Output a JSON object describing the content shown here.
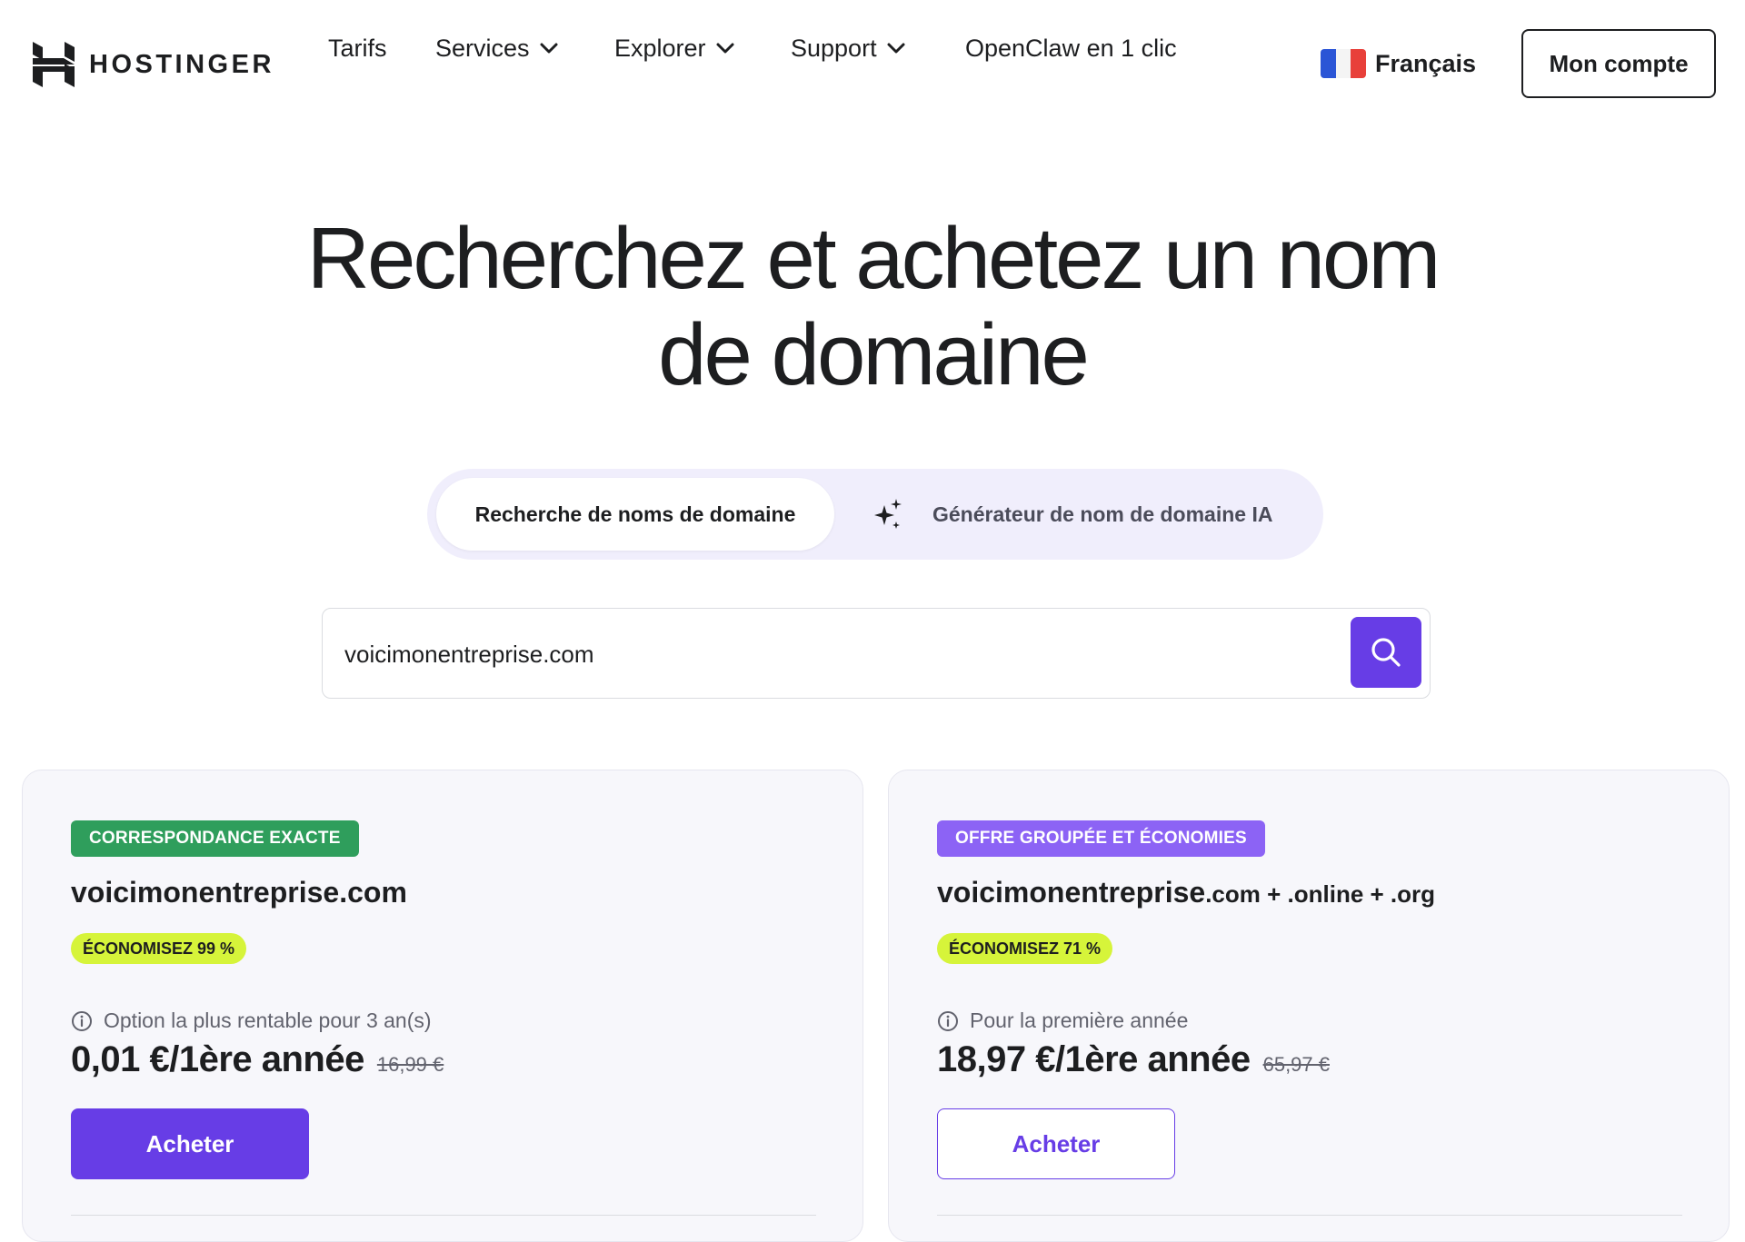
{
  "header": {
    "logo_text": "HOSTINGER",
    "nav": [
      {
        "label": "Tarifs",
        "has_dropdown": false
      },
      {
        "label": "Services",
        "has_dropdown": true
      },
      {
        "label": "Explorer",
        "has_dropdown": true
      },
      {
        "label": "Support",
        "has_dropdown": true
      },
      {
        "label": "OpenClaw en 1 clic",
        "has_dropdown": false
      }
    ],
    "language": "Français",
    "account_button": "Mon compte"
  },
  "hero": {
    "title_line1": "Recherchez et achetez un nom",
    "title_line2": "de domaine"
  },
  "tabs": {
    "search_tab": "Recherche de noms de domaine",
    "ai_tab": "Générateur de nom de domaine IA"
  },
  "search": {
    "value": "voicimonentreprise.com"
  },
  "cards": [
    {
      "tag": "CORRESPONDANCE EXACTE",
      "domain": "voicimonentreprise.com",
      "domain_suffix": "",
      "save": "ÉCONOMISEZ 99 %",
      "info": "Option la plus rentable pour 3 an(s)",
      "price": "0,01 €/1ère année",
      "old_price": "16,99 €",
      "button": "Acheter"
    },
    {
      "tag": "OFFRE GROUPÉE ET ÉCONOMIES",
      "domain": "voicimonentreprise",
      "domain_suffix": ".com + .online + .org",
      "save": "ÉCONOMISEZ 71 %",
      "info": "Pour la première année",
      "price": "18,97 €/1ère année",
      "old_price": "65,97 €",
      "button": "Acheter"
    }
  ],
  "colors": {
    "brand_purple": "#673de6",
    "tag_green": "#2f9e5c",
    "tag_purple": "#8c63f5",
    "save_badge": "#d6f43a"
  }
}
